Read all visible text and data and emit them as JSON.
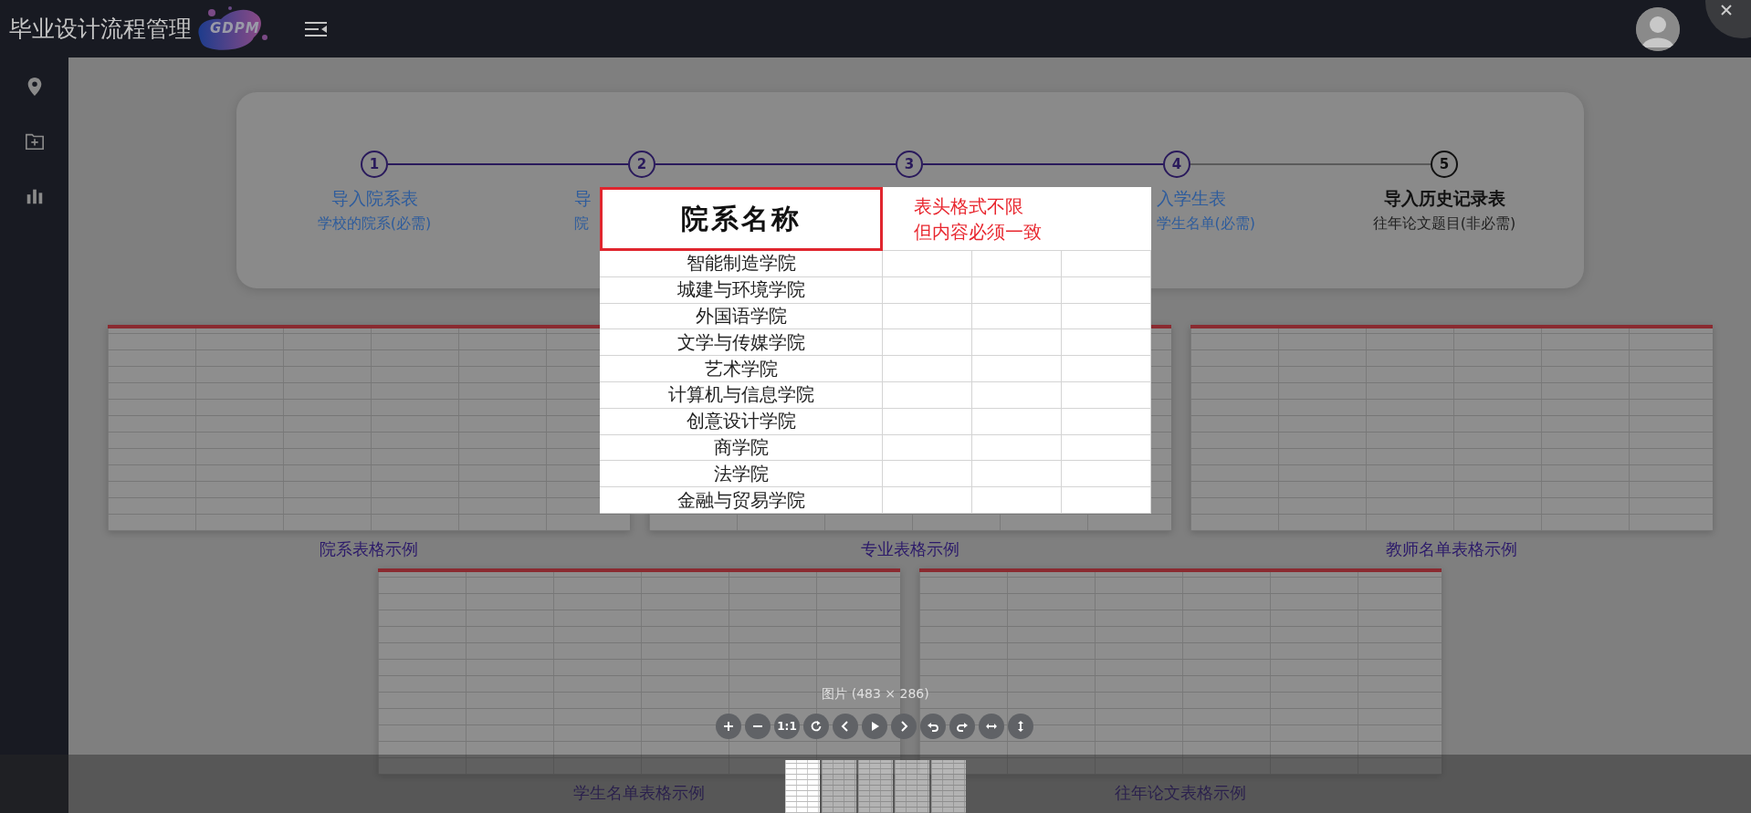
{
  "header": {
    "title": "毕业设计流程管理",
    "logo_text": "GDPM"
  },
  "steps": [
    {
      "number": "1",
      "title": "导入院系表",
      "subtitle": "学校的院系(必需)",
      "current": false
    },
    {
      "number": "2",
      "title": "导",
      "subtitle": "院",
      "current": false,
      "end_hidden": true
    },
    {
      "number": "3",
      "current": false
    },
    {
      "number": "4",
      "title": "入学生表",
      "subtitle": "学生名单(必需)",
      "current": false,
      "start_hidden": true
    },
    {
      "number": "5",
      "title": "导入历史记录表",
      "subtitle": "往年论文题目(非必需)",
      "current": true
    }
  ],
  "examples": [
    {
      "caption": "院系表格示例"
    },
    {
      "caption": "专业表格示例"
    },
    {
      "caption": "教师名单表格示例"
    },
    {
      "caption": "学生名单表格示例"
    },
    {
      "caption": "往年论文表格示例"
    }
  ],
  "viewer": {
    "image": {
      "header": "院系名称",
      "note": [
        "表头格式不限",
        "但内容必须一致"
      ],
      "rows": [
        "智能制造学院",
        "城建与环境学院",
        "外国语学院",
        "文学与传媒学院",
        "艺术学院",
        "计算机与信息学院",
        "创意设计学院",
        "商学院",
        "法学院",
        "金融与贸易学院"
      ]
    },
    "size_label": "图片 (483 × 286)",
    "reset_label": "1:1",
    "thumbnails": [
      {
        "selected": true
      },
      {
        "selected": false
      },
      {
        "selected": false
      },
      {
        "selected": false
      },
      {
        "selected": false
      }
    ]
  }
}
